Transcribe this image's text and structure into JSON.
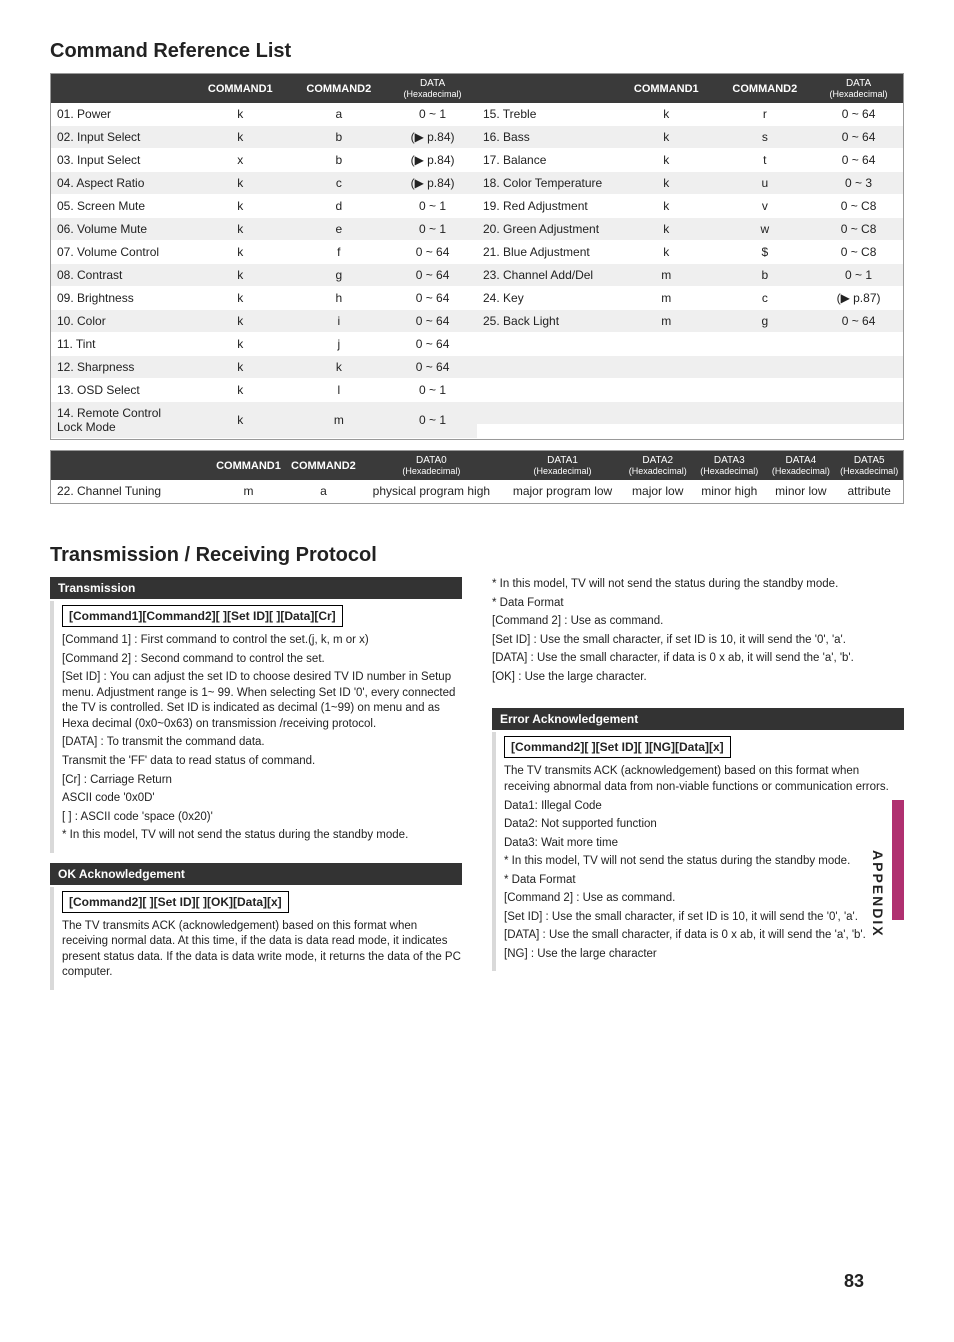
{
  "headings": {
    "crl": "Command Reference List",
    "trp": "Transmission / Receiving  Protocol"
  },
  "table_headers": {
    "cmd1": "COMMAND1",
    "cmd2": "COMMAND2",
    "data_hex": "DATA",
    "hex_sub": "(Hexadecimal)",
    "d0": "DATA0",
    "d1": "DATA1",
    "d2": "DATA2",
    "d3": "DATA3",
    "d4": "DATA4",
    "d5": "DATA5"
  },
  "left_rows": [
    {
      "name": "01. Power",
      "c1": "k",
      "c2": "a",
      "d": "0 ~ 1"
    },
    {
      "name": "02. Input Select",
      "c1": "k",
      "c2": "b",
      "d": "(▶ p.84)"
    },
    {
      "name": "03. Input Select",
      "c1": "x",
      "c2": "b",
      "d": "(▶ p.84)"
    },
    {
      "name": "04. Aspect Ratio",
      "c1": "k",
      "c2": "c",
      "d": "(▶ p.84)"
    },
    {
      "name": "05. Screen Mute",
      "c1": "k",
      "c2": "d",
      "d": "0 ~ 1"
    },
    {
      "name": "06. Volume Mute",
      "c1": "k",
      "c2": "e",
      "d": "0 ~ 1"
    },
    {
      "name": "07. Volume Control",
      "c1": "k",
      "c2": "f",
      "d": "0 ~ 64"
    },
    {
      "name": "08. Contrast",
      "c1": "k",
      "c2": "g",
      "d": "0 ~ 64"
    },
    {
      "name": "09. Brightness",
      "c1": "k",
      "c2": "h",
      "d": "0 ~ 64"
    },
    {
      "name": "10. Color",
      "c1": "k",
      "c2": "i",
      "d": "0 ~ 64"
    },
    {
      "name": "11. Tint",
      "c1": "k",
      "c2": "j",
      "d": "0 ~ 64"
    },
    {
      "name": "12. Sharpness",
      "c1": "k",
      "c2": "k",
      "d": "0 ~ 64"
    },
    {
      "name": "13. OSD Select",
      "c1": "k",
      "c2": "l",
      "d": "0 ~ 1"
    },
    {
      "name": "14. Remote Control\n      Lock Mode",
      "c1": "k",
      "c2": "m",
      "d": "0 ~ 1"
    }
  ],
  "right_rows": [
    {
      "name": "15. Treble",
      "c1": "k",
      "c2": "r",
      "d": "0 ~ 64"
    },
    {
      "name": "16. Bass",
      "c1": "k",
      "c2": "s",
      "d": "0 ~ 64"
    },
    {
      "name": "17. Balance",
      "c1": "k",
      "c2": "t",
      "d": "0 ~ 64"
    },
    {
      "name": "18. Color Temperature",
      "c1": "k",
      "c2": "u",
      "d": "0 ~ 3"
    },
    {
      "name": "19. Red Adjustment",
      "c1": "k",
      "c2": "v",
      "d": "0 ~ C8"
    },
    {
      "name": "20. Green Adjustment",
      "c1": "k",
      "c2": "w",
      "d": "0 ~ C8"
    },
    {
      "name": "21. Blue Adjustment",
      "c1": "k",
      "c2": "$",
      "d": "0 ~ C8"
    },
    {
      "name": "23. Channel Add/Del",
      "c1": "m",
      "c2": "b",
      "d": "0 ~ 1"
    },
    {
      "name": "24. Key",
      "c1": "m",
      "c2": "c",
      "d": "(▶ p.87)"
    },
    {
      "name": "25. Back Light",
      "c1": "m",
      "c2": "g",
      "d": "0 ~ 64"
    }
  ],
  "ch_tuning": {
    "name": "22. Channel Tuning",
    "c1": "m",
    "c2": "a",
    "d0": "physical program high",
    "d1": "major program low",
    "d2": "major low",
    "d3": "minor high",
    "d4": "minor low",
    "d5": "attribute"
  },
  "protocol": {
    "transmission_title": "Transmission",
    "trans_fmt": "[Command1][Command2][  ][Set ID][  ][Data][Cr]",
    "trans_lines": [
      "[Command 1] : First command to control the set.(j, k, m or x)",
      "[Command 2] : Second command to control the set.",
      "[Set ID] : You can adjust the set ID to choose desired TV ID number in Setup menu. Adjustment range is 1~ 99. When selecting Set ID '0', every connected the TV is controlled. Set ID is indicated as decimal (1~99) on menu and as Hexa decimal (0x0~0x63) on transmission /receiving protocol.",
      "[DATA] : To transmit the command data.",
      "Transmit the 'FF' data to read status of command.",
      "[Cr] : Carriage Return",
      "ASCII code '0x0D'",
      "[  ] : ASCII code 'space (0x20)'",
      "* In this model, TV will not send the status during the standby mode."
    ],
    "ok_title": "OK Acknowledgement",
    "ok_fmt": "[Command2][  ][Set ID][  ][OK][Data][x]",
    "ok_lines": [
      "The TV transmits ACK (acknowledgement) based on this format when receiving normal data. At this time, if the data is data read mode, it indicates present status data. If the data is data write mode, it returns the data of the PC computer."
    ],
    "right_top": [
      "* In this model, TV will not send the status during the standby mode.",
      "* Data Format",
      "[Command 2] : Use as command.",
      "[Set ID] : Use the small character, if set ID is 10, it will send the '0', 'a'.",
      "[DATA] : Use the small character, if data is 0 x ab, it will send the 'a', 'b'.",
      "[OK] : Use the large character."
    ],
    "err_title": "Error Acknowledgement",
    "err_fmt": "[Command2][  ][Set ID][  ][NG][Data][x]",
    "err_lines": [
      "The TV transmits ACK (acknowledgement) based on this format when receiving abnormal data from non-viable functions or communication errors.",
      "Data1: Illegal Code",
      "Data2: Not supported function",
      "Data3: Wait more time",
      "* In this model, TV will not send the status during the standby mode.",
      "* Data Format",
      "[Command 2] : Use as command.",
      "[Set ID] : Use the small character, if set ID is 10, it will send the '0', 'a'.",
      "[DATA] : Use the small character, if data is 0 x ab, it will send the 'a', 'b'.",
      "[NG] : Use the large character"
    ]
  },
  "side": {
    "label": "APPENDIX",
    "page": "83"
  }
}
